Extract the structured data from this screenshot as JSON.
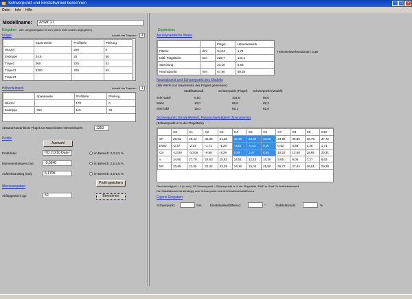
{
  "window": {
    "title": "Schwerpunkt und Einstellwinkel berechnen",
    "min": "_",
    "max": "□",
    "close": "×"
  },
  "menu": [
    "Datei",
    "Info",
    "Hilfe"
  ],
  "left": {
    "modelname_label": "Modellname:",
    "modelname_value": "ASW 17",
    "eingaben_label": "Eingaben",
    "eingaben_hint": "Alle Längenangaben in mm (wenn nicht anders angegeben)",
    "fluegel_link": "Flügel",
    "fluegel_anzahl": "Anzahl der Trapeze:",
    "fluegel_anzahl_value": "4",
    "fluegel_cols": [
      "",
      "Spannweite",
      "Profiltiefe",
      "Pfeilung"
    ],
    "fluegel_rows": [
      [
        "Wurzel",
        "",
        "260",
        "0"
      ],
      [
        "Endrippe",
        "24.5",
        "25",
        "56"
      ],
      [
        "Trapez",
        "360",
        "225",
        "51"
      ],
      [
        "Trapez2",
        "5300",
        "208",
        "53"
      ],
      [
        "Trapez3",
        "",
        "",
        ""
      ]
    ],
    "hlw_link": "Höhenleitwerk",
    "hlw_anzahl": "Anzahl der Trapeze:",
    "hlw_anzahl_value": "1",
    "hlw_cols": [
      "",
      "Spannweite",
      "Profiltiefe",
      "Pfeilung"
    ],
    "hlw_rows": [
      [
        "Wurzel",
        "",
        "170",
        "0"
      ],
      [
        "Endrippe",
        "310",
        "110",
        "30"
      ]
    ],
    "abstand_label": "Abstand Nasenleiste Flügel zur Nasenleiste Höhenleitwerk:",
    "abstand_value": "1350",
    "profil_link": "Profile",
    "profil_btn": "Auswahl",
    "profil_fields": [
      {
        "label": "Profildicke:",
        "value": "HQ 2,0/10 Datei"
      },
      {
        "label": "Momentenbeiwert cm0:",
        "value": "-0,0640"
      },
      {
        "label": "Auftriebsanstieg (rad):",
        "value": "6,1700"
      }
    ],
    "radios": [
      "im Bereich: 2,0-2,5 %",
      "im Bereich: 2,5-3,5 %",
      "im Bereich: 3,5-5,0 %"
    ],
    "profil_btn2": "Profil speichern",
    "masse_link": "Masseangaben",
    "masse_label": "Abfluggewicht (g):",
    "masse_value": "50",
    "berechnen_btn": "Berechnen"
  },
  "right": {
    "ergebnisse": "Ergebnisse",
    "aero_link": "Aerodynamische Werte",
    "aero_cols": [
      "",
      "",
      "Flügel",
      "Höhenleitwerk"
    ],
    "aero_rows": [
      [
        "Fläche",
        "dm²",
        "34,04",
        "1,72"
      ],
      [
        "Mittl. Flügeltiefe",
        "mm",
        "228,7",
        "133,1"
      ],
      [
        "Streckung",
        "",
        "23,10",
        "5,56"
      ],
      [
        "Neutralpunkt",
        "mm",
        "67,80",
        "89,39"
      ]
    ],
    "aero_note": "Höhenleitwerksvolumen: 0,38",
    "np_link": "Neutralpunkt und Schwerpunkt des Modells",
    "np_sub": "(alle Werte von Nasenleiste des Flügels gemessen)",
    "np_cols": [
      "Stabilitätsmaß",
      "Schwerpunkt (Flügel)",
      "Schwerpunkt (Modell)"
    ],
    "np_rows": [
      [
        "sehr stabil",
        "5,00",
        "104,5",
        "88,0"
      ],
      [
        "stabil",
        "10,0",
        "99,8",
        "85,3"
      ],
      [
        "eher labil",
        "15,0",
        "95,1",
        "82,6"
      ]
    ],
    "sw_link": "Schwerpunkt, Einstellwinkel, Flugeschwindigkeit (Grenzwerte)",
    "sw_sub": "(Schwerpunkt in % der Flügeltiefe)",
    "sw_cols": [
      "",
      "C0",
      "C1",
      "C2",
      "C3",
      "C4",
      "C5",
      "C6",
      "C7",
      "C8",
      "C9",
      "C10"
    ],
    "sw_rows": [
      [
        "SP",
        "28,53",
        "29,42",
        "30,35",
        "31,28",
        "32,18",
        "33,09",
        "34,00",
        "34,95",
        "35,86",
        "36,79",
        "37,72"
      ],
      [
        "EWD",
        "-2,57",
        "-2,14",
        "-1,71",
        "-1,28",
        "-0,85",
        "-0,42",
        "0,00",
        "0,42",
        "0,85",
        "1,28",
        "1,71"
      ],
      [
        "Ca",
        "-13,50",
        "-10,08",
        "-6,68",
        "-3,29",
        "0,09",
        "3,47",
        "6,85",
        "10,22",
        "13,58",
        "16,95",
        "20,31"
      ],
      [
        "v",
        "34,80",
        "27,79",
        "22,63",
        "15,82",
        "14,51",
        "12,13",
        "10,38",
        "9,06",
        "8,05",
        "7,27",
        "6,63"
      ],
      [
        "NP",
        "20,69",
        "21,55",
        "22,42",
        "23,29",
        "24,16",
        "25,02",
        "25,90",
        "26,77",
        "27,64",
        "28,51",
        "29,38"
      ]
    ],
    "sw_note1": "Geschwindigkeit = 1 (In m/s), SP Schwerpunkt = Schwerpunkt in % der Flügeltiefe, EWD in Grad Ca Auftriebsbeiwert",
    "sw_note2": "Die Stabilitätszahl ist abhängig vom Schwerpunkt und der Einstellwinkeldifferenz",
    "eigene_link": "Eigene Eingaben",
    "eigene": [
      {
        "label": "Schwerpunkt:",
        "unit": "mm"
      },
      {
        "label": "Einstellwinkeldifferenz:",
        "unit": "°"
      },
      {
        "label": "Stabilitätsmaß:",
        "unit": "%"
      }
    ]
  },
  "colors": {
    "window_bg": "#c0c0c0",
    "title_blue": "#0b3fb8",
    "selection": "#3a8ee6",
    "link": "#1b2fd0",
    "heading": "#0a7a1a"
  }
}
